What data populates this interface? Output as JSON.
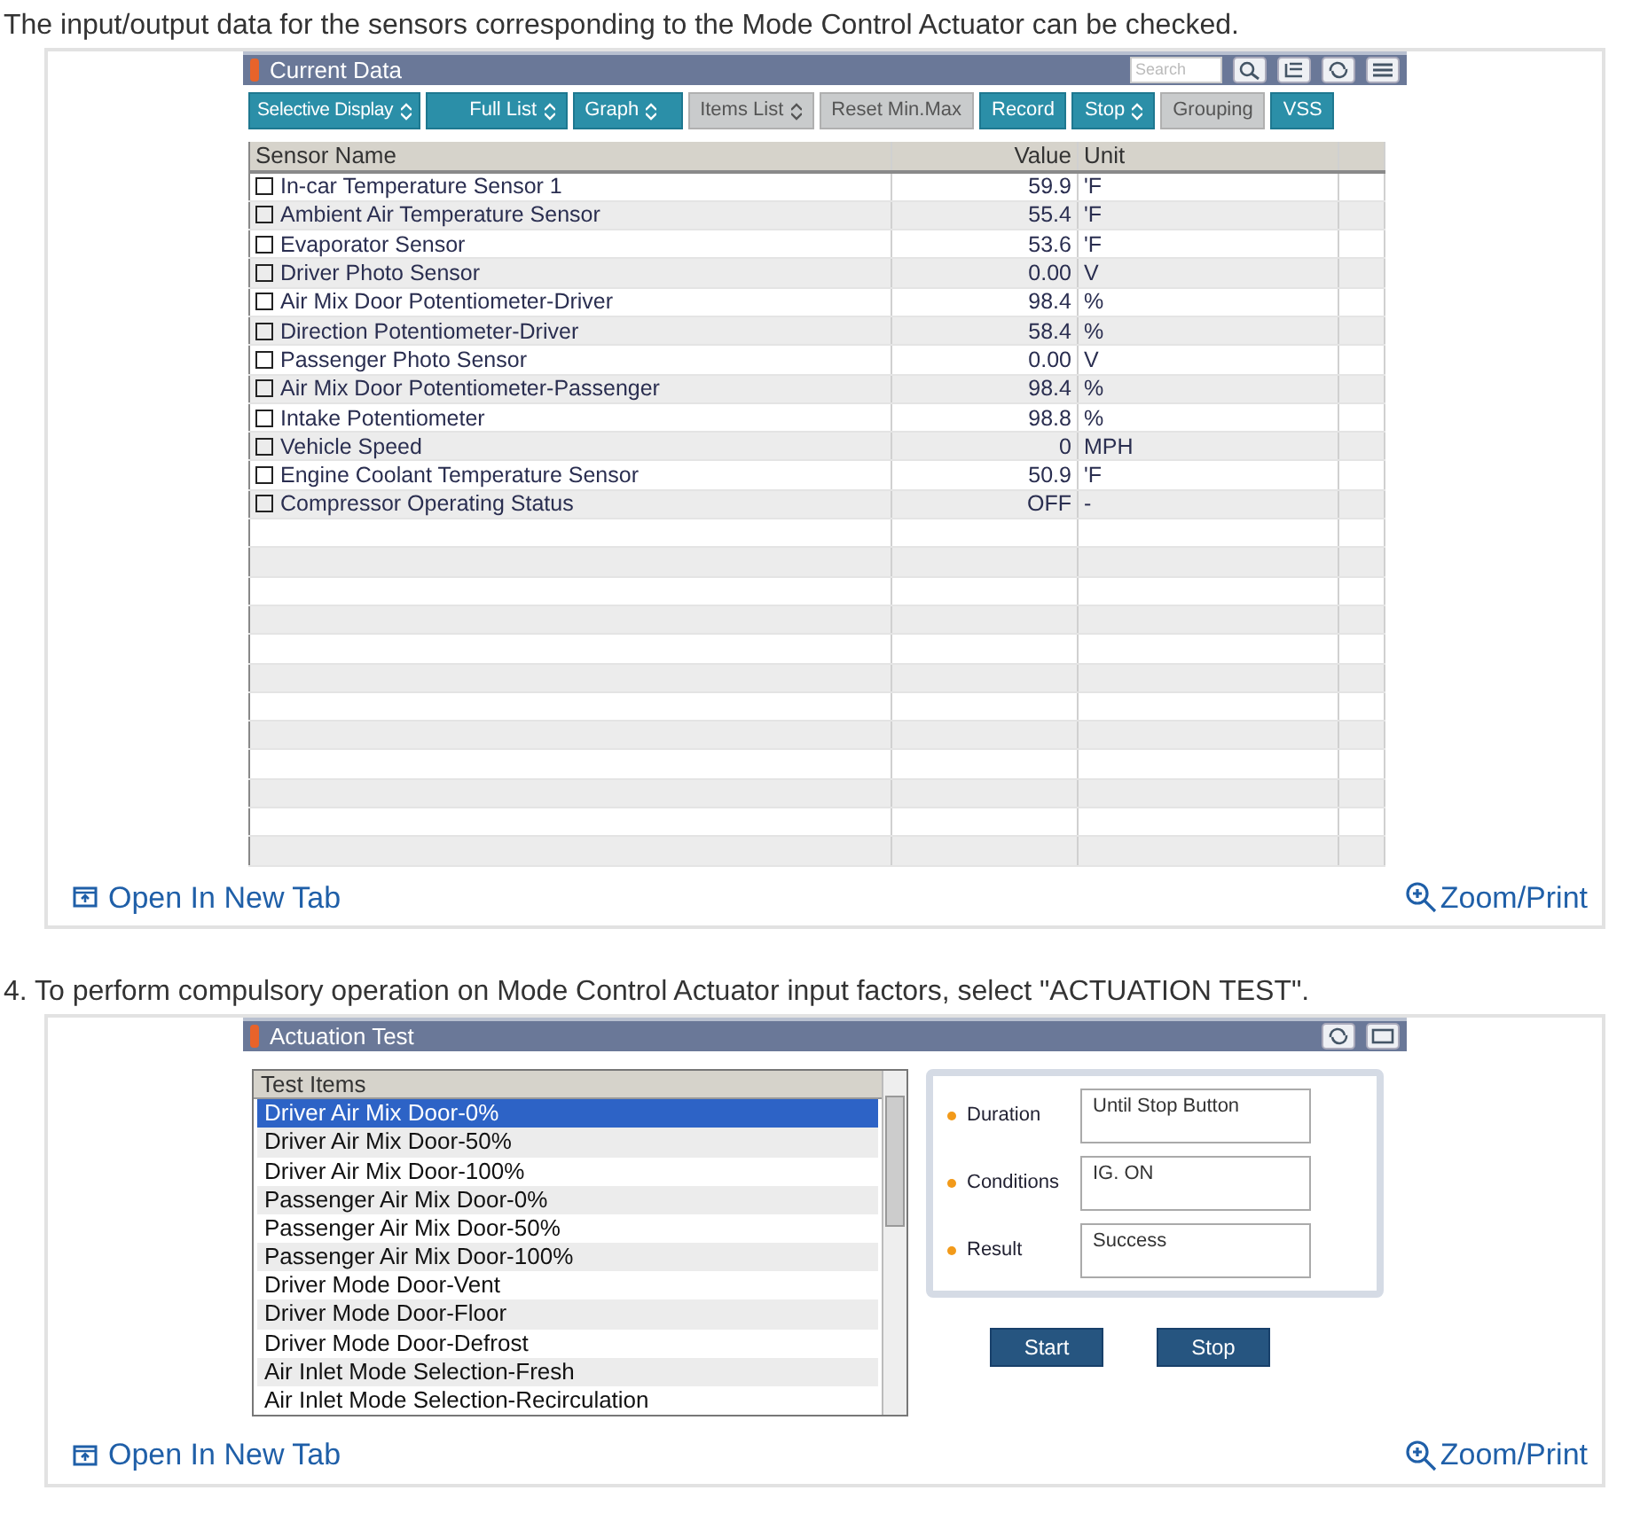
{
  "sections": [
    {
      "intro": "The input/output data for the sensors corresponding to the Mode Control Actuator can be checked.",
      "panel": {
        "kind": "current_data",
        "title": "Current Data",
        "search": {
          "placeholder": "Search"
        },
        "toolbar": [
          {
            "label": "Selective Display",
            "dropdown": true,
            "disabled": false
          },
          {
            "label": "Full List",
            "dropdown": true,
            "disabled": false
          },
          {
            "label": "Graph",
            "dropdown": true,
            "disabled": false
          },
          {
            "label": "Items List",
            "dropdown": true,
            "disabled": true
          },
          {
            "label": "Reset Min.Max",
            "dropdown": false,
            "disabled": true
          },
          {
            "label": "Record",
            "dropdown": false,
            "disabled": false
          },
          {
            "label": "Stop",
            "dropdown": true,
            "disabled": false
          },
          {
            "label": "Grouping",
            "dropdown": false,
            "disabled": true
          },
          {
            "label": "VSS",
            "dropdown": false,
            "disabled": false
          }
        ],
        "columns": [
          "Sensor Name",
          "Value",
          "Unit"
        ],
        "rows": [
          {
            "name": "In-car Temperature Sensor 1",
            "value": "59.9",
            "unit": "'F",
            "checked": false
          },
          {
            "name": "Ambient Air Temperature Sensor",
            "value": "55.4",
            "unit": "'F",
            "checked": false
          },
          {
            "name": "Evaporator Sensor",
            "value": "53.6",
            "unit": "'F",
            "checked": false
          },
          {
            "name": "Driver Photo Sensor",
            "value": "0.00",
            "unit": "V",
            "checked": false
          },
          {
            "name": "Air Mix Door Potentiometer-Driver",
            "value": "98.4",
            "unit": "%",
            "checked": false
          },
          {
            "name": "Direction Potentiometer-Driver",
            "value": "58.4",
            "unit": "%",
            "checked": false
          },
          {
            "name": "Passenger Photo Sensor",
            "value": "0.00",
            "unit": "V",
            "checked": false
          },
          {
            "name": "Air Mix Door Potentiometer-Passenger",
            "value": "98.4",
            "unit": "%",
            "checked": false
          },
          {
            "name": "Intake Potentiometer",
            "value": "98.8",
            "unit": "%",
            "checked": false
          },
          {
            "name": "Vehicle Speed",
            "value": "0",
            "unit": "MPH",
            "checked": false
          },
          {
            "name": "Engine Coolant Temperature Sensor",
            "value": "50.9",
            "unit": "'F",
            "checked": false
          },
          {
            "name": "Compressor Operating Status",
            "value": "OFF",
            "unit": "-",
            "checked": false
          }
        ]
      },
      "links": {
        "open": "Open In New Tab",
        "zoom": "Zoom/Print"
      }
    },
    {
      "intro": "4. To perform compulsory operation on Mode Control Actuator input factors, select \"ACTUATION TEST\".",
      "panel": {
        "kind": "actuation_test",
        "title": "Actuation Test",
        "list_header": "Test Items",
        "items": [
          {
            "label": "Driver Air Mix Door-0%",
            "selected": true
          },
          {
            "label": "Driver Air Mix Door-50%",
            "selected": false
          },
          {
            "label": "Driver Air Mix Door-100%",
            "selected": false
          },
          {
            "label": "Passenger Air Mix Door-0%",
            "selected": false
          },
          {
            "label": "Passenger Air Mix Door-50%",
            "selected": false
          },
          {
            "label": "Passenger Air Mix Door-100%",
            "selected": false
          },
          {
            "label": "Driver Mode Door-Vent",
            "selected": false
          },
          {
            "label": "Driver Mode Door-Floor",
            "selected": false
          },
          {
            "label": "Driver Mode Door-Defrost",
            "selected": false
          },
          {
            "label": "Air Inlet Mode Selection-Fresh",
            "selected": false
          },
          {
            "label": "Air Inlet Mode Selection-Recirculation",
            "selected": false
          }
        ],
        "fields": [
          {
            "label": "Duration",
            "value": "Until Stop Button"
          },
          {
            "label": "Conditions",
            "value": "IG. ON"
          },
          {
            "label": "Result",
            "value": "Success"
          }
        ],
        "buttons": [
          "Start",
          "Stop"
        ]
      },
      "links": {
        "open": "Open In New Tab",
        "zoom": "Zoom/Print"
      }
    }
  ]
}
